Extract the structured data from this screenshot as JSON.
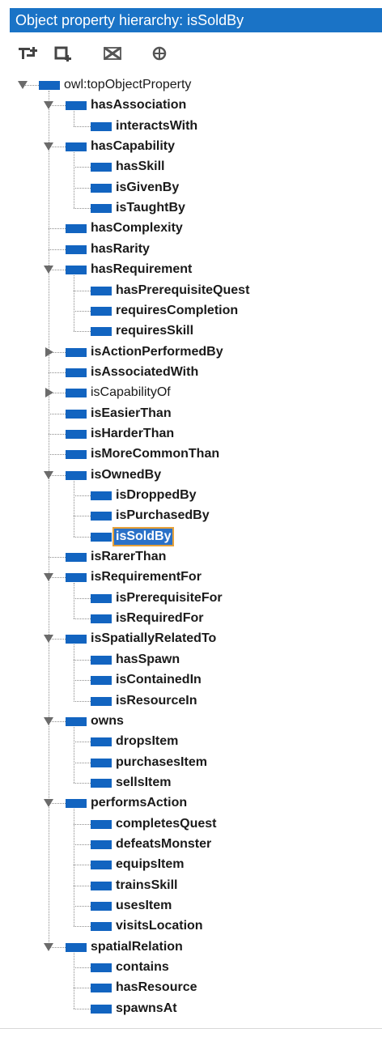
{
  "title": "Object property hierarchy: isSoldBy",
  "toolbar": {
    "buttons": [
      {
        "name": "add-subproperty-button",
        "icon": "add-subproperty-icon"
      },
      {
        "name": "add-sibling-property-button",
        "icon": "add-sibling-property-icon"
      },
      {
        "name": "delete-property-button",
        "icon": "delete-property-icon"
      },
      {
        "name": "find-usage-button",
        "icon": "find-usage-icon"
      }
    ]
  },
  "colors": {
    "titlebar": "#1a73c6",
    "property_icon": "#1264c0",
    "selection": "#2a71c8",
    "selection_border": "#e6a13a"
  },
  "tree": [
    {
      "label": "owl:topObjectProperty",
      "depth": 0,
      "toggle": "open",
      "weight": "normal"
    },
    {
      "label": "hasAssociation",
      "depth": 1,
      "toggle": "open"
    },
    {
      "label": "interactsWith",
      "depth": 2
    },
    {
      "label": "hasCapability",
      "depth": 1,
      "toggle": "open"
    },
    {
      "label": "hasSkill",
      "depth": 2
    },
    {
      "label": "isGivenBy",
      "depth": 2
    },
    {
      "label": "isTaughtBy",
      "depth": 2
    },
    {
      "label": "hasComplexity",
      "depth": 1
    },
    {
      "label": "hasRarity",
      "depth": 1
    },
    {
      "label": "hasRequirement",
      "depth": 1,
      "toggle": "open"
    },
    {
      "label": "hasPrerequisiteQuest",
      "depth": 2
    },
    {
      "label": "requiresCompletion",
      "depth": 2
    },
    {
      "label": "requiresSkill",
      "depth": 2
    },
    {
      "label": "isActionPerformedBy",
      "depth": 1,
      "toggle": "closed"
    },
    {
      "label": "isAssociatedWith",
      "depth": 1
    },
    {
      "label": "isCapabilityOf",
      "depth": 1,
      "toggle": "closed",
      "weight": "normal"
    },
    {
      "label": "isEasierThan",
      "depth": 1
    },
    {
      "label": "isHarderThan",
      "depth": 1
    },
    {
      "label": "isMoreCommonThan",
      "depth": 1
    },
    {
      "label": "isOwnedBy",
      "depth": 1,
      "toggle": "open"
    },
    {
      "label": "isDroppedBy",
      "depth": 2
    },
    {
      "label": "isPurchasedBy",
      "depth": 2
    },
    {
      "label": "isSoldBy",
      "depth": 2,
      "selected": true
    },
    {
      "label": "isRarerThan",
      "depth": 1
    },
    {
      "label": "isRequirementFor",
      "depth": 1,
      "toggle": "open"
    },
    {
      "label": "isPrerequisiteFor",
      "depth": 2
    },
    {
      "label": "isRequiredFor",
      "depth": 2
    },
    {
      "label": "isSpatiallyRelatedTo",
      "depth": 1,
      "toggle": "open"
    },
    {
      "label": "hasSpawn",
      "depth": 2
    },
    {
      "label": "isContainedIn",
      "depth": 2
    },
    {
      "label": "isResourceIn",
      "depth": 2
    },
    {
      "label": "owns",
      "depth": 1,
      "toggle": "open"
    },
    {
      "label": "dropsItem",
      "depth": 2
    },
    {
      "label": "purchasesItem",
      "depth": 2
    },
    {
      "label": "sellsItem",
      "depth": 2
    },
    {
      "label": "performsAction",
      "depth": 1,
      "toggle": "open"
    },
    {
      "label": "completesQuest",
      "depth": 2
    },
    {
      "label": "defeatsMonster",
      "depth": 2
    },
    {
      "label": "equipsItem",
      "depth": 2
    },
    {
      "label": "trainsSkill",
      "depth": 2
    },
    {
      "label": "usesItem",
      "depth": 2
    },
    {
      "label": "visitsLocation",
      "depth": 2
    },
    {
      "label": "spatialRelation",
      "depth": 1,
      "toggle": "open"
    },
    {
      "label": "contains",
      "depth": 2
    },
    {
      "label": "hasResource",
      "depth": 2
    },
    {
      "label": "spawnsAt",
      "depth": 2
    }
  ]
}
